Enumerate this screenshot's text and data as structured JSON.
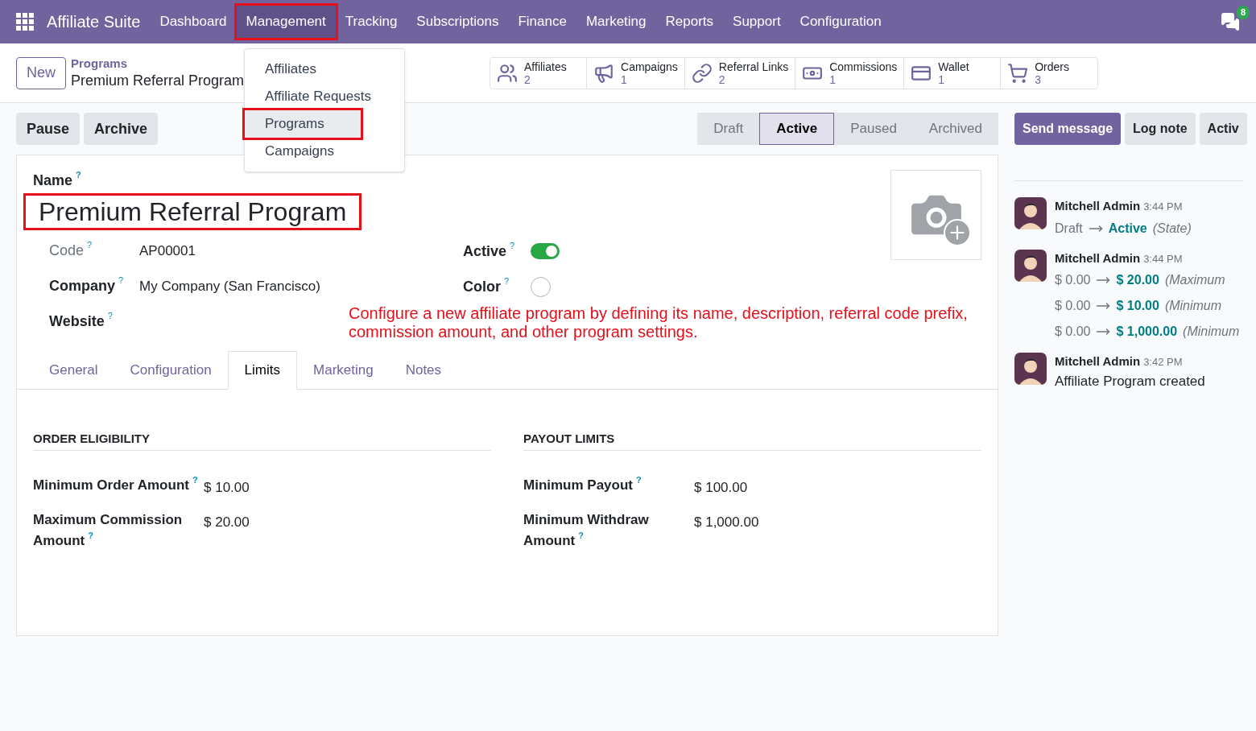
{
  "navbar": {
    "app_name": "Affiliate Suite",
    "menus": [
      {
        "label": "Dashboard",
        "selected": false,
        "annotated": false
      },
      {
        "label": "Management",
        "selected": true,
        "annotated": true
      },
      {
        "label": "Tracking",
        "selected": false,
        "annotated": false
      },
      {
        "label": "Subscriptions",
        "selected": false,
        "annotated": false
      },
      {
        "label": "Finance",
        "selected": false,
        "annotated": false
      },
      {
        "label": "Marketing",
        "selected": false,
        "annotated": false
      },
      {
        "label": "Reports",
        "selected": false,
        "annotated": false
      },
      {
        "label": "Support",
        "selected": false,
        "annotated": false
      },
      {
        "label": "Configuration",
        "selected": false,
        "annotated": false
      }
    ],
    "chat_badge": "8"
  },
  "dropdown": {
    "items": [
      {
        "label": "Affiliates",
        "highlighted": false,
        "annotated": false
      },
      {
        "label": "Affiliate Requests",
        "highlighted": false,
        "annotated": false
      },
      {
        "label": "Programs",
        "highlighted": true,
        "annotated": true
      },
      {
        "label": "Campaigns",
        "highlighted": false,
        "annotated": false
      }
    ]
  },
  "new_button": "New",
  "breadcrumb": {
    "parent": "Programs",
    "current": "Premium Referral Program"
  },
  "smart_buttons": [
    {
      "kind": "users",
      "label": "Affiliates",
      "count": "2"
    },
    {
      "kind": "megaphone",
      "label": "Campaigns",
      "count": "1"
    },
    {
      "kind": "link",
      "label": "Referral Links",
      "count": "2"
    },
    {
      "kind": "money",
      "label": "Commissions",
      "count": "1"
    },
    {
      "kind": "card",
      "label": "Wallet",
      "count": "1"
    },
    {
      "kind": "cart",
      "label": "Orders",
      "count": "3"
    }
  ],
  "actions": [
    "Pause",
    "Archive"
  ],
  "statusbar": [
    {
      "label": "Draft",
      "selected": false
    },
    {
      "label": "Active",
      "selected": true
    },
    {
      "label": "Paused",
      "selected": false
    },
    {
      "label": "Archived",
      "selected": false
    }
  ],
  "chatter_buttons": [
    {
      "label": "Send message",
      "primary": true
    },
    {
      "label": "Log note",
      "primary": false
    },
    {
      "label": "Activ",
      "primary": false
    }
  ],
  "form": {
    "name_label": "Name",
    "name_help": "?",
    "name": "Premium Referral Program",
    "name_annotated": true,
    "left_fields": [
      {
        "label": "Code",
        "help": "?",
        "value": "AP00001",
        "muted": true
      },
      {
        "label": "Company",
        "help": "?",
        "value": "My Company (San Francisco)",
        "muted": false
      },
      {
        "label": "Website",
        "help": "?",
        "muted": false
      }
    ],
    "active": {
      "label": "Active",
      "help": "?",
      "on": true
    },
    "color": {
      "label": "Color",
      "help": "?"
    },
    "annotation": "Configure a new affiliate program by defining its name, description, referral code prefix, commission amount, and other program settings.",
    "tabs": [
      {
        "label": "General",
        "selected": false
      },
      {
        "label": "Configuration",
        "selected": false
      },
      {
        "label": "Limits",
        "selected": true
      },
      {
        "label": "Marketing",
        "selected": false
      },
      {
        "label": "Notes",
        "selected": false
      }
    ],
    "sections": [
      {
        "title": "ORDER ELIGIBILITY",
        "fields": [
          {
            "label": "Minimum Order Amount",
            "help": "?",
            "value": "$ 10.00"
          },
          {
            "label": "Maximum Commission Amount",
            "help": "?",
            "value": "$ 20.00"
          }
        ]
      },
      {
        "title": "PAYOUT LIMITS",
        "fields": [
          {
            "label": "Minimum Payout",
            "help": "?",
            "value": "$ 100.00"
          },
          {
            "label": "Minimum Withdraw Amount",
            "help": "?",
            "value": "$ 1,000.00"
          }
        ]
      }
    ]
  },
  "chatter": {
    "messages": [
      {
        "author": "Mitchell Admin",
        "time": "3:44 PM",
        "lines": [
          {
            "kind": "tracking",
            "old": "Draft",
            "new": "Active",
            "field": "(State)"
          }
        ]
      },
      {
        "author": "Mitchell Admin",
        "time": "3:44 PM",
        "lines": [
          {
            "kind": "tracking",
            "old": "$ 0.00",
            "new": "$ 20.00",
            "field": "(Maximum"
          },
          {
            "kind": "tracking",
            "old": "$ 0.00",
            "new": "$ 10.00",
            "field": "(Minimum"
          },
          {
            "kind": "tracking",
            "old": "$ 0.00",
            "new": "$ 1,000.00",
            "field": "(Minimum"
          }
        ]
      },
      {
        "author": "Mitchell Admin",
        "time": "3:42 PM",
        "lines": [
          {
            "kind": "text",
            "body": "Affiliate Program created"
          }
        ]
      }
    ]
  }
}
